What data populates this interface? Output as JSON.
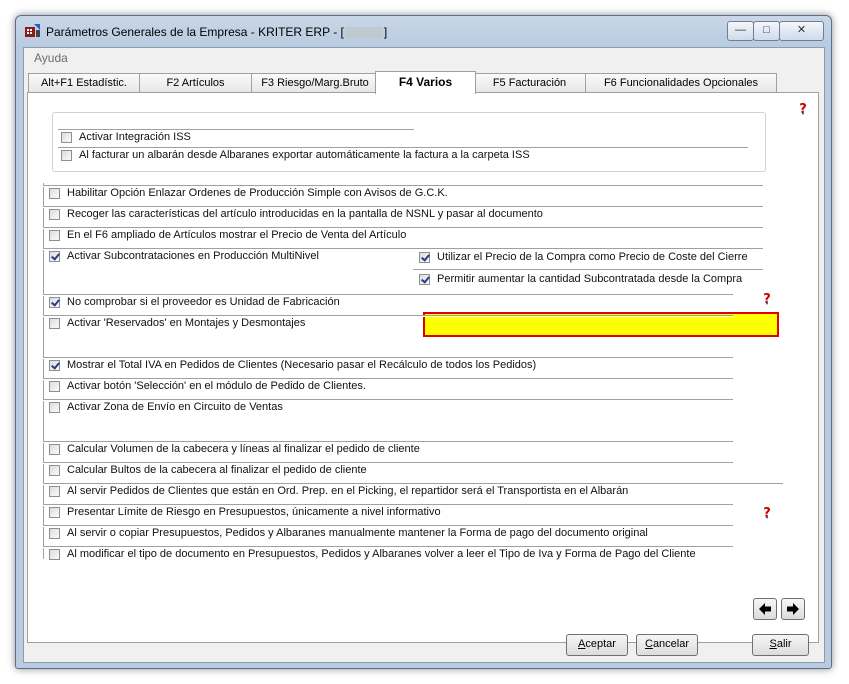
{
  "window": {
    "title_prefix": "Parámetros Generales de la Empresa - KRITER ERP - [",
    "title_suffix": "]",
    "minimize_label": "—",
    "maximize_label": "□",
    "close_label": "✕"
  },
  "menu": {
    "items": [
      "Ayuda"
    ]
  },
  "tabs": [
    {
      "label": "Alt+F1 Estadístic.",
      "active": false
    },
    {
      "label": "F2 Artículos",
      "active": false
    },
    {
      "label": "F3 Riesgo/Marg.Bruto",
      "active": false
    },
    {
      "label": "F4 Varios",
      "active": true
    },
    {
      "label": "F5 Facturación",
      "active": false
    },
    {
      "label": "F6 Funcionalidades Opcionales",
      "active": false
    }
  ],
  "options": {
    "isa_integration": {
      "label": "Activar Integración ISS",
      "checked": false
    },
    "export_invoice": {
      "label": "Al facturar un albarán desde Albaranes exportar automáticamente la factura a la carpeta ISS",
      "checked": false
    },
    "link_orders": {
      "label": "Habilitar Opción Enlazar Ordenes de Producción Simple con Avisos de G.C.K.",
      "checked": false
    },
    "collect_features": {
      "label": "Recoger las características del artículo introducidas en la pantalla de NSNL y pasar al documento",
      "checked": false
    },
    "f6_price": {
      "label": "En el F6 ampliado de Artículos mostrar el Precio de Venta del Artículo",
      "checked": false
    },
    "subcontract_multilevel": {
      "label": "Activar Subcontrataciones en Producción MultiNivel",
      "checked": true
    },
    "use_purchase_price": {
      "label": "Utilizar el Precio de la Compra como Precio de Coste del Cierre",
      "checked": true
    },
    "allow_increase_qty": {
      "label": "Permitir aumentar la cantidad Subcontratada desde la Compra",
      "checked": true
    },
    "no_check_supplier": {
      "label": "No comprobar si el proveedor es Unidad de Fabricación",
      "checked": true
    },
    "reserved_assembly": {
      "label": "Activar 'Reservados' en Montajes y Desmontajes",
      "checked": false
    },
    "show_total_iva": {
      "label": "Mostrar el Total IVA en Pedidos de Clientes (Necesario pasar el Recálculo de todos los Pedidos)",
      "checked": true
    },
    "selection_button": {
      "label": "Activar botón 'Selección' en el módulo de Pedido de Clientes.",
      "checked": false
    },
    "shipping_zone": {
      "label": "Activar Zona de Envío en Circuito de Ventas",
      "checked": false
    },
    "calc_volume": {
      "label": "Calcular Volumen de la cabecera y líneas al finalizar el pedido de cliente",
      "checked": false
    },
    "calc_bulks": {
      "label": "Calcular Bultos de la cabecera al finalizar el pedido de cliente",
      "checked": false
    },
    "serve_orders": {
      "label": "Al servir Pedidos de Clientes que están en Ord. Prep. en el Picking, el repartidor será el Transportista en el Albarán",
      "checked": false
    },
    "risk_limit": {
      "label": "Presentar Límite de Riesgo en Presupuestos, únicamente a nivel informativo",
      "checked": false
    },
    "keep_payment": {
      "label": "Al servir o copiar Presupuestos, Pedidos y Albaranes manualmente mantener la Forma de pago del documento original",
      "checked": false
    },
    "reread_iva": {
      "label": "Al modificar el tipo de documento en Presupuestos, Pedidos y Albaranes volver a leer el Tipo de Iva y Forma de Pago del Cliente",
      "checked": false
    }
  },
  "buttons": {
    "accept_accel": "A",
    "accept_rest": "ceptar",
    "cancel_accel": "C",
    "cancel_rest": "ancelar",
    "exit_accel": "S",
    "exit_rest": "alir",
    "prev_label": "🡐",
    "next_label": "🡒"
  },
  "colors": {
    "highlight_fill": "#ffff00",
    "highlight_border": "#e00000",
    "help_icon": "#cc0000"
  },
  "icons": [
    "app-icon",
    "help-icon",
    "arrow-left-icon",
    "arrow-right-icon"
  ]
}
